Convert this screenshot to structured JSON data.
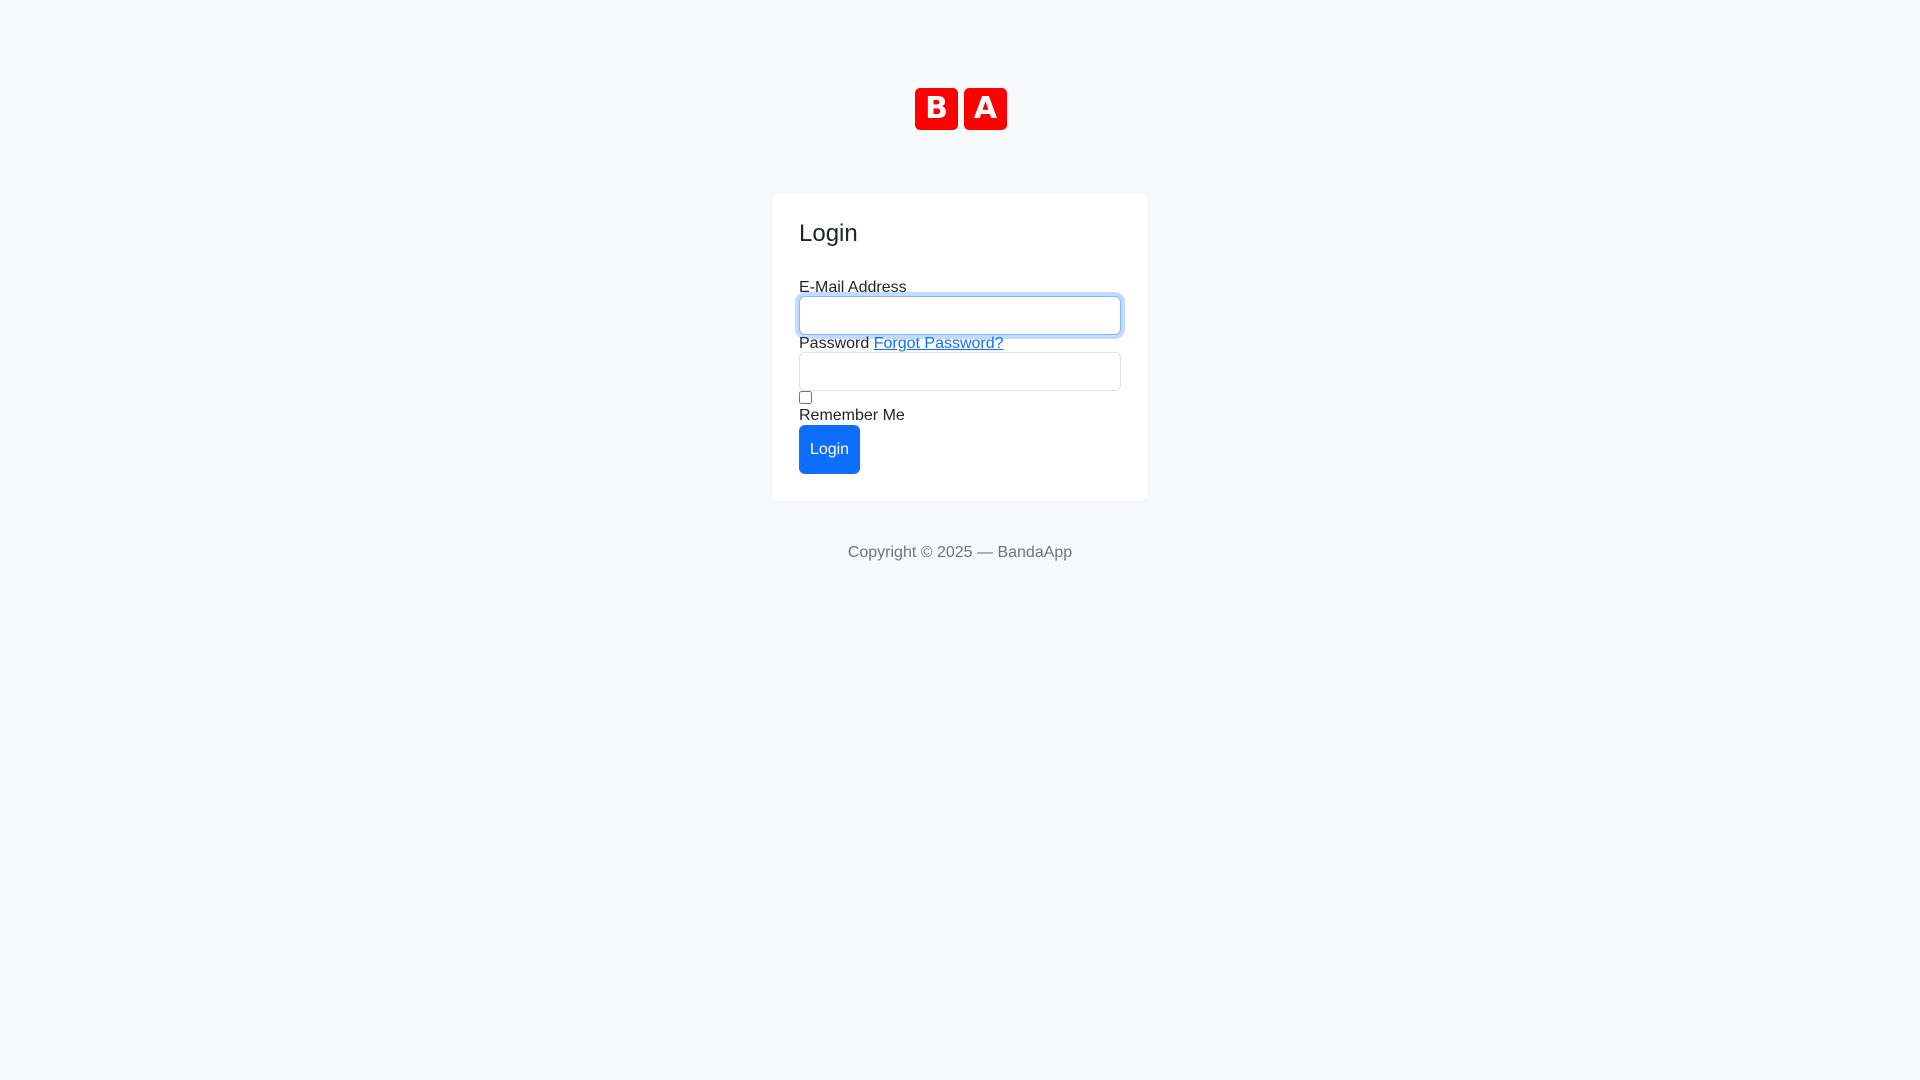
{
  "logo": {
    "letters": [
      "B",
      "A"
    ],
    "color": "#ff0000"
  },
  "login_form": {
    "title": "Login",
    "email_label": "E-Mail Address",
    "email_value": "",
    "password_label": "Password",
    "forgot_password": "Forgot Password?",
    "password_value": "",
    "remember_checked": false,
    "remember_label": "Remember Me",
    "submit_label": "Login"
  },
  "footer": {
    "copyright": "Copyright © 2025 — BandaApp"
  },
  "colors": {
    "primary": "#0d6efd",
    "background": "#f8f9fa",
    "card": "#ffffff",
    "muted_text": "#6c757d"
  }
}
